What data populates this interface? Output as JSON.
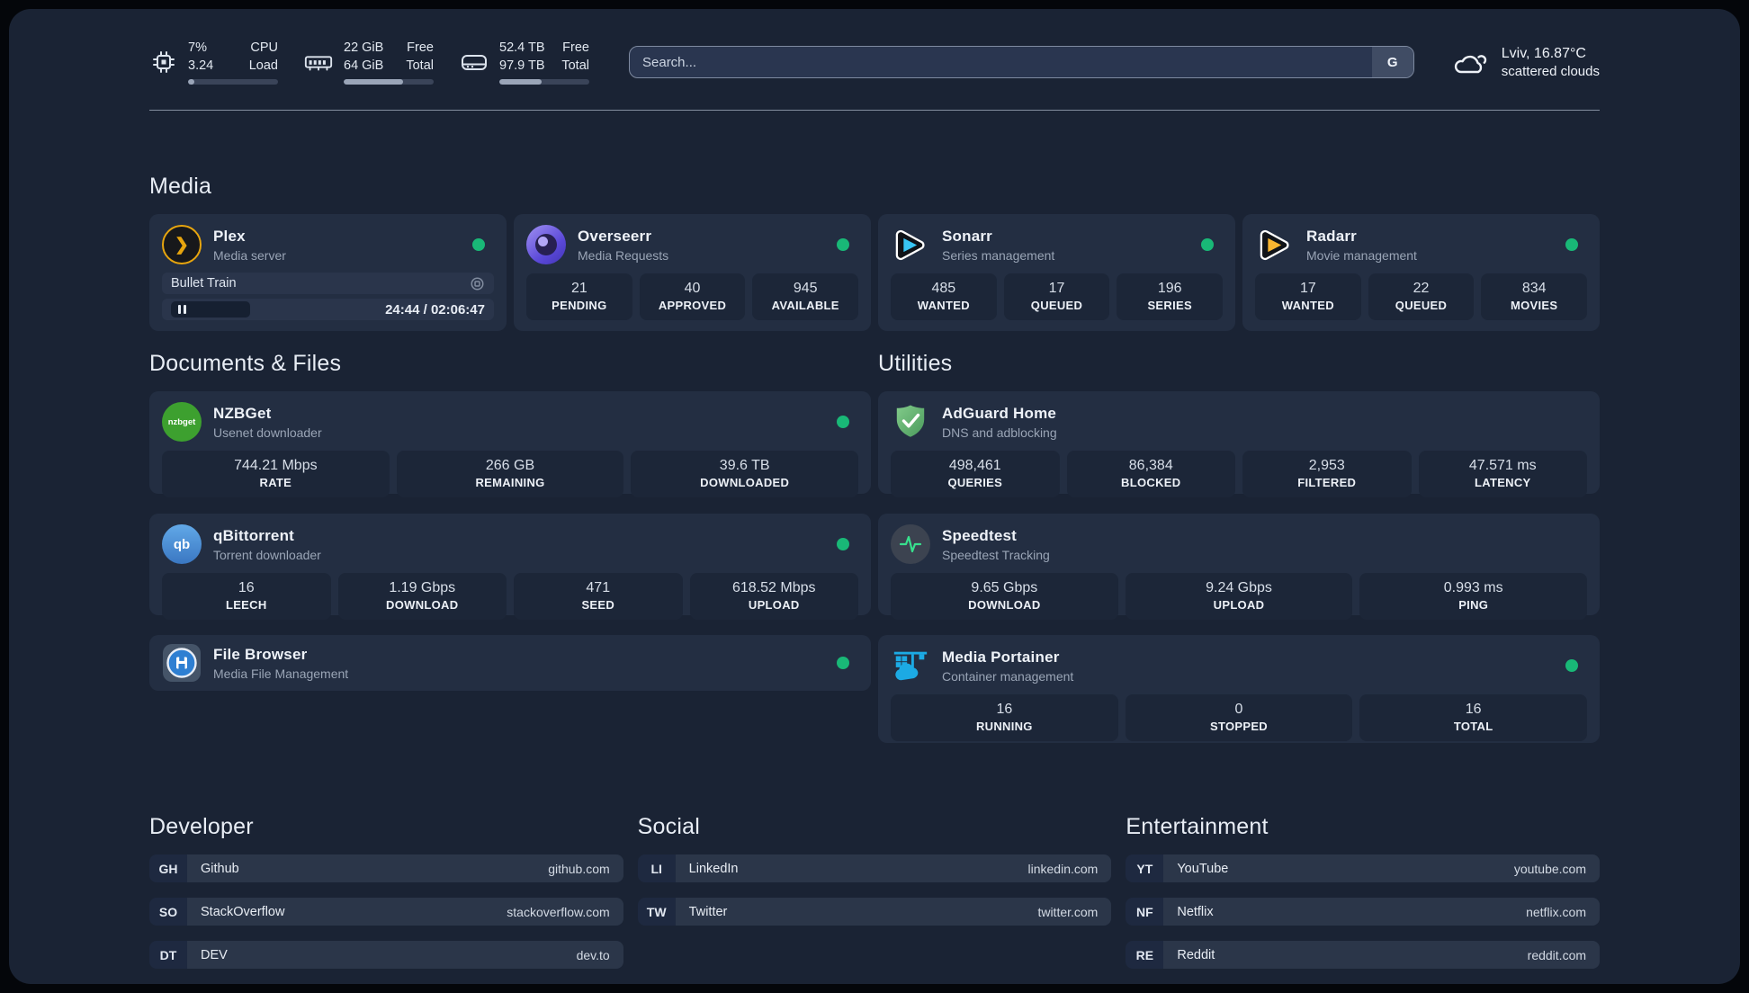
{
  "topbar": {
    "cpu": {
      "line1_value": "7%",
      "line2_value": "3.24",
      "line1_label": "CPU",
      "line2_label": "Load",
      "progress": 7
    },
    "memory": {
      "line1_value": "22 GiB",
      "line2_value": "64 GiB",
      "line1_label": "Free",
      "line2_label": "Total",
      "progress": 66
    },
    "storage": {
      "line1_value": "52.4 TB",
      "line2_value": "97.9 TB",
      "line1_label": "Free",
      "line2_label": "Total",
      "progress": 47
    },
    "search": {
      "placeholder": "Search...",
      "engine_label": "G"
    },
    "weather": {
      "location": "Lviv, 16.87°C",
      "condition": "scattered clouds"
    }
  },
  "sections": {
    "media": "Media",
    "documents": "Documents & Files",
    "utilities": "Utilities",
    "developer": "Developer",
    "social": "Social",
    "entertainment": "Entertainment"
  },
  "apps": {
    "plex": {
      "name": "Plex",
      "desc": "Media server",
      "now_playing": "Bullet Train",
      "time": "24:44 / 02:06:47"
    },
    "overseerr": {
      "name": "Overseerr",
      "desc": "Media Requests",
      "stats": [
        {
          "value": "21",
          "label": "PENDING"
        },
        {
          "value": "40",
          "label": "APPROVED"
        },
        {
          "value": "945",
          "label": "AVAILABLE"
        }
      ]
    },
    "sonarr": {
      "name": "Sonarr",
      "desc": "Series management",
      "stats": [
        {
          "value": "485",
          "label": "WANTED"
        },
        {
          "value": "17",
          "label": "QUEUED"
        },
        {
          "value": "196",
          "label": "SERIES"
        }
      ]
    },
    "radarr": {
      "name": "Radarr",
      "desc": "Movie management",
      "stats": [
        {
          "value": "17",
          "label": "WANTED"
        },
        {
          "value": "22",
          "label": "QUEUED"
        },
        {
          "value": "834",
          "label": "MOVIES"
        }
      ]
    },
    "nzbget": {
      "name": "NZBGet",
      "desc": "Usenet downloader",
      "icon_text": "nzbget",
      "stats": [
        {
          "value": "744.21 Mbps",
          "label": "RATE"
        },
        {
          "value": "266 GB",
          "label": "REMAINING"
        },
        {
          "value": "39.6 TB",
          "label": "DOWNLOADED"
        }
      ]
    },
    "adguard": {
      "name": "AdGuard Home",
      "desc": "DNS and adblocking",
      "stats": [
        {
          "value": "498,461",
          "label": "QUERIES"
        },
        {
          "value": "86,384",
          "label": "BLOCKED"
        },
        {
          "value": "2,953",
          "label": "FILTERED"
        },
        {
          "value": "47.571 ms",
          "label": "LATENCY"
        }
      ]
    },
    "qbittorrent": {
      "name": "qBittorrent",
      "desc": "Torrent downloader",
      "icon_text": "qb",
      "stats": [
        {
          "value": "16",
          "label": "LEECH"
        },
        {
          "value": "1.19 Gbps",
          "label": "DOWNLOAD"
        },
        {
          "value": "471",
          "label": "SEED"
        },
        {
          "value": "618.52 Mbps",
          "label": "UPLOAD"
        }
      ]
    },
    "speedtest": {
      "name": "Speedtest",
      "desc": "Speedtest Tracking",
      "stats": [
        {
          "value": "9.65 Gbps",
          "label": "DOWNLOAD"
        },
        {
          "value": "9.24 Gbps",
          "label": "UPLOAD"
        },
        {
          "value": "0.993 ms",
          "label": "PING"
        }
      ]
    },
    "filebrowser": {
      "name": "File Browser",
      "desc": "Media File Management"
    },
    "portainer": {
      "name": "Media Portainer",
      "desc": "Container management",
      "stats": [
        {
          "value": "16",
          "label": "RUNNING"
        },
        {
          "value": "0",
          "label": "STOPPED"
        },
        {
          "value": "16",
          "label": "TOTAL"
        }
      ]
    }
  },
  "links": {
    "developer": {
      "items": [
        {
          "abbr": "GH",
          "name": "Github",
          "url": "github.com"
        },
        {
          "abbr": "SO",
          "name": "StackOverflow",
          "url": "stackoverflow.com"
        },
        {
          "abbr": "DT",
          "name": "DEV",
          "url": "dev.to"
        }
      ]
    },
    "social": {
      "items": [
        {
          "abbr": "LI",
          "name": "LinkedIn",
          "url": "linkedin.com"
        },
        {
          "abbr": "TW",
          "name": "Twitter",
          "url": "twitter.com"
        }
      ]
    },
    "entertainment": {
      "items": [
        {
          "abbr": "YT",
          "name": "YouTube",
          "url": "youtube.com"
        },
        {
          "abbr": "NF",
          "name": "Netflix",
          "url": "netflix.com"
        },
        {
          "abbr": "RE",
          "name": "Reddit",
          "url": "reddit.com"
        }
      ]
    }
  },
  "colors": {
    "status_green": "#19b877",
    "plex_gold": "#e7a50e",
    "sonarr_blue": "#38c6f4",
    "radarr_orange": "#f9b630",
    "nzbget_green": "#3da02f",
    "qbittorrent_blue": "#4b8fd6",
    "adguard_green": "#67b279",
    "portainer_blue": "#1caae4",
    "speedtest_pulse": "#37e08d",
    "filebrowser_blue": "#2e7fd2",
    "overseerr_purple": "#5b49d8"
  }
}
